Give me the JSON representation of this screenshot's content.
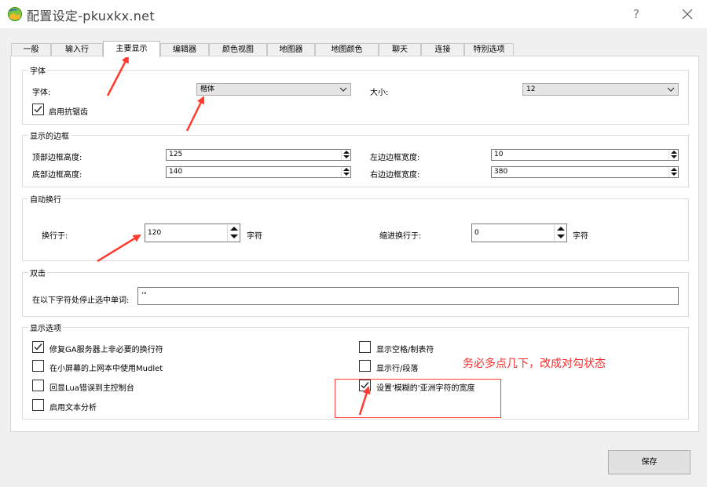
{
  "window": {
    "title": "配置设定-pkuxkx.net",
    "help": "?"
  },
  "tabs": [
    {
      "label": "一般"
    },
    {
      "label": "输入行"
    },
    {
      "label": "主要显示"
    },
    {
      "label": "编辑器"
    },
    {
      "label": "颜色视图"
    },
    {
      "label": "地图器"
    },
    {
      "label": "地图颜色"
    },
    {
      "label": "聊天"
    },
    {
      "label": "连接"
    },
    {
      "label": "特别选项"
    }
  ],
  "font_group": {
    "title": "字体",
    "font_label": "字体:",
    "font_value": "楷体",
    "size_label": "大小:",
    "size_value": "12",
    "antialias_label": "启用抗锯齿",
    "antialias_checked": true
  },
  "border_group": {
    "title": "显示的边框",
    "top_label": "顶部边框高度:",
    "top_value": "125",
    "left_label": "左边边框宽度:",
    "left_value": "10",
    "bottom_label": "底部边框高度:",
    "bottom_value": "140",
    "right_label": "右边边框宽度:",
    "right_value": "380"
  },
  "wrap_group": {
    "title": "自动换行",
    "wrap_label": "换行于:",
    "wrap_value": "120",
    "wrap_unit": "字符",
    "indent_label": "缩进换行于:",
    "indent_value": "0",
    "indent_unit": "字符"
  },
  "dblclick_group": {
    "title": "双击",
    "stop_label": "在以下字符处停止选中单词:",
    "stop_value": "'\""
  },
  "display_options": {
    "title": "显示选项",
    "items": [
      {
        "label": "修复GA服务器上非必要的换行符",
        "checked": true
      },
      {
        "label": "在小屏幕的上网本中使用Mudlet",
        "checked": false
      },
      {
        "label": "回显Lua错误到主控制台",
        "checked": false
      },
      {
        "label": "启用文本分析",
        "checked": false
      },
      {
        "label": "显示空格/制表符",
        "checked": false
      },
      {
        "label": "显示行/段落",
        "checked": false
      },
      {
        "label": "设置'模糊的'亚洲字符的宽度",
        "checked": true
      }
    ]
  },
  "annotation": {
    "text": "务必多点几下，改成对勾状态",
    "color": "#ff2a2a"
  },
  "footer": {
    "save_label": "保存"
  },
  "colors": {
    "window_bg": "#f0f0f0",
    "panel_bg": "#ffffff",
    "annotation_red": "#ff3b30"
  }
}
